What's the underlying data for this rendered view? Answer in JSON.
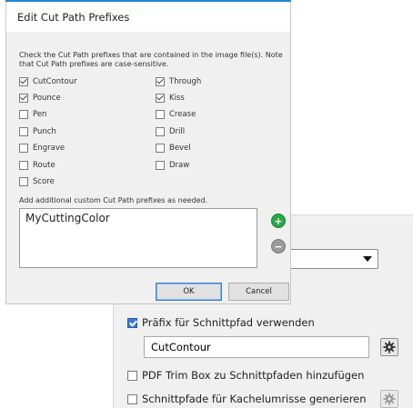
{
  "dialog": {
    "title": "Edit Cut Path Prefixes",
    "intro": "Check the Cut Path prefixes that are contained in the image file(s). Note that Cut Path prefixes are case-sensitive.",
    "prefixes_left": [
      {
        "label": "CutContour",
        "checked": true
      },
      {
        "label": "Pounce",
        "checked": true
      },
      {
        "label": "Pen",
        "checked": false
      },
      {
        "label": "Punch",
        "checked": false
      },
      {
        "label": "Engrave",
        "checked": false
      },
      {
        "label": "Route",
        "checked": false
      },
      {
        "label": "Score",
        "checked": false
      }
    ],
    "prefixes_right": [
      {
        "label": "Through",
        "checked": true
      },
      {
        "label": "Kiss",
        "checked": true
      },
      {
        "label": "Crease",
        "checked": false
      },
      {
        "label": "Drill",
        "checked": false
      },
      {
        "label": "Bevel",
        "checked": false
      },
      {
        "label": "Draw",
        "checked": false
      }
    ],
    "add_hint": "Add additional custom Cut Path prefixes as needed.",
    "custom_prefixes": [
      "MyCuttingColor"
    ],
    "ok_label": "OK",
    "cancel_label": "Cancel",
    "add_icon": "plus-icon",
    "remove_icon": "minus-icon"
  },
  "settings": {
    "use_prefix_label": "Präfix für Schnittpfad verwenden",
    "use_prefix_checked": true,
    "prefix_value": "CutContour",
    "pdf_trim_label": "PDF Trim Box zu Schnittpfaden hinzufügen",
    "pdf_trim_checked": false,
    "tile_outline_label": "Schnittpfade für Kachelumrisse generieren",
    "tile_outline_checked": false,
    "gear_icon": "gear-icon"
  },
  "colors": {
    "accent": "#1e88d6",
    "plus_green": "#27a844",
    "checkbox_blue": "#3a7bd5"
  }
}
